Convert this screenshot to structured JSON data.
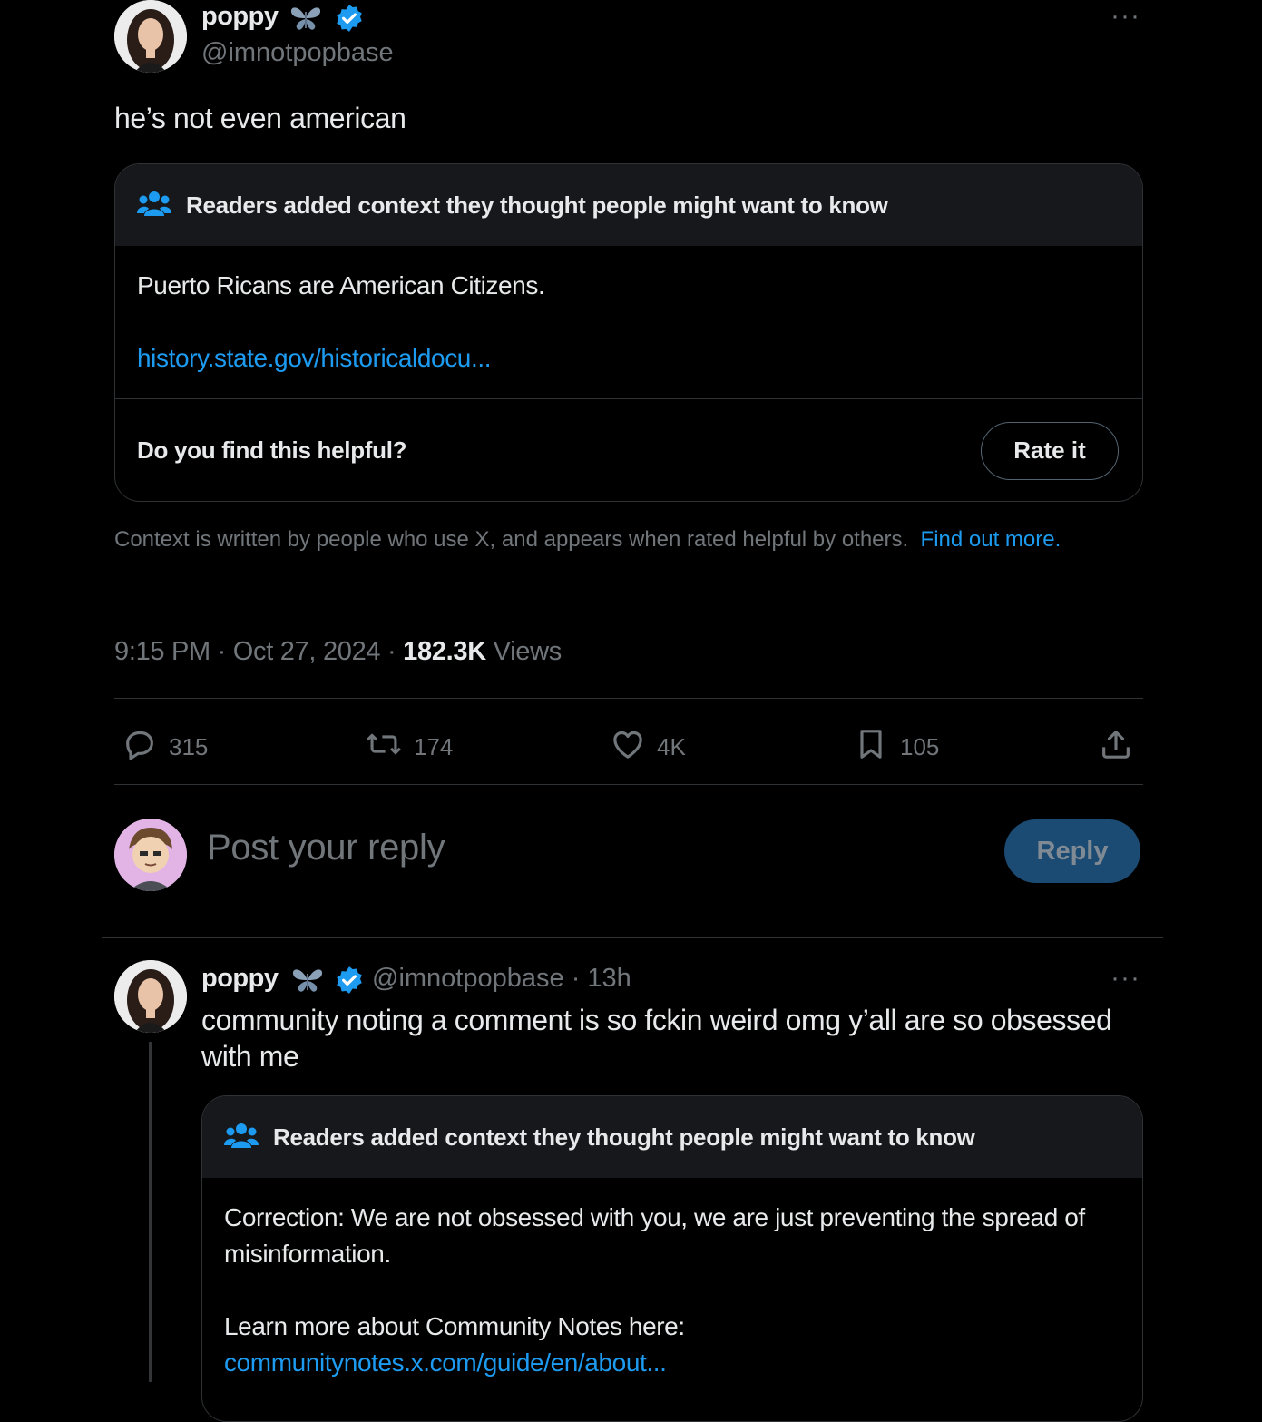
{
  "main_tweet": {
    "author_name": "poppy",
    "handle": "@imnotpopbase",
    "more_label": "···",
    "text": "he’s not even american",
    "note": {
      "header": "Readers added context they thought people might want to know",
      "body": "Puerto Ricans are American Citizens.",
      "link": "history.state.gov/historicaldocu...",
      "helpful_question": "Do you find this helpful?",
      "rate_label": "Rate it"
    },
    "disclaimer": {
      "text": "Context is written by people who use X, and appears when rated helpful by others.",
      "link": "Find out more."
    },
    "meta": {
      "time": "9:15 PM",
      "separator": "·",
      "date": "Oct 27, 2024",
      "views_count": "182.3K",
      "views_label": "Views"
    },
    "actions": {
      "replies": "315",
      "reposts": "174",
      "likes": "4K",
      "bookmarks": "105"
    }
  },
  "reply_composer": {
    "placeholder": "Post your reply",
    "button_label": "Reply"
  },
  "reply_tweet": {
    "author_name": "poppy",
    "handle": "@imnotpopbase",
    "time_ago": "· 13h",
    "more_label": "···",
    "text": "community noting a comment is so fckin weird omg y’all are so obsessed with me",
    "note": {
      "header": "Readers added context they thought people might want to know",
      "body": "Correction: We are not obsessed with you, we are just preventing the spread of misinformation.",
      "learn_more": "Learn more about Community Notes here:",
      "link": "communitynotes.x.com/guide/en/about..."
    }
  },
  "colors": {
    "background": "#000000",
    "text": "#e7e9ea",
    "secondary": "#71767b",
    "accent": "#1d9bf0",
    "verified": "#1d9bf0",
    "border": "#2f3336",
    "reply_button_disabled": "#1b4a72"
  },
  "icons": {
    "butterfly": "butterfly-icon",
    "verified": "verified-badge-icon",
    "community": "community-notes-icon",
    "reply": "reply-icon",
    "repost": "repost-icon",
    "like": "heart-icon",
    "bookmark": "bookmark-icon",
    "share": "share-icon"
  }
}
